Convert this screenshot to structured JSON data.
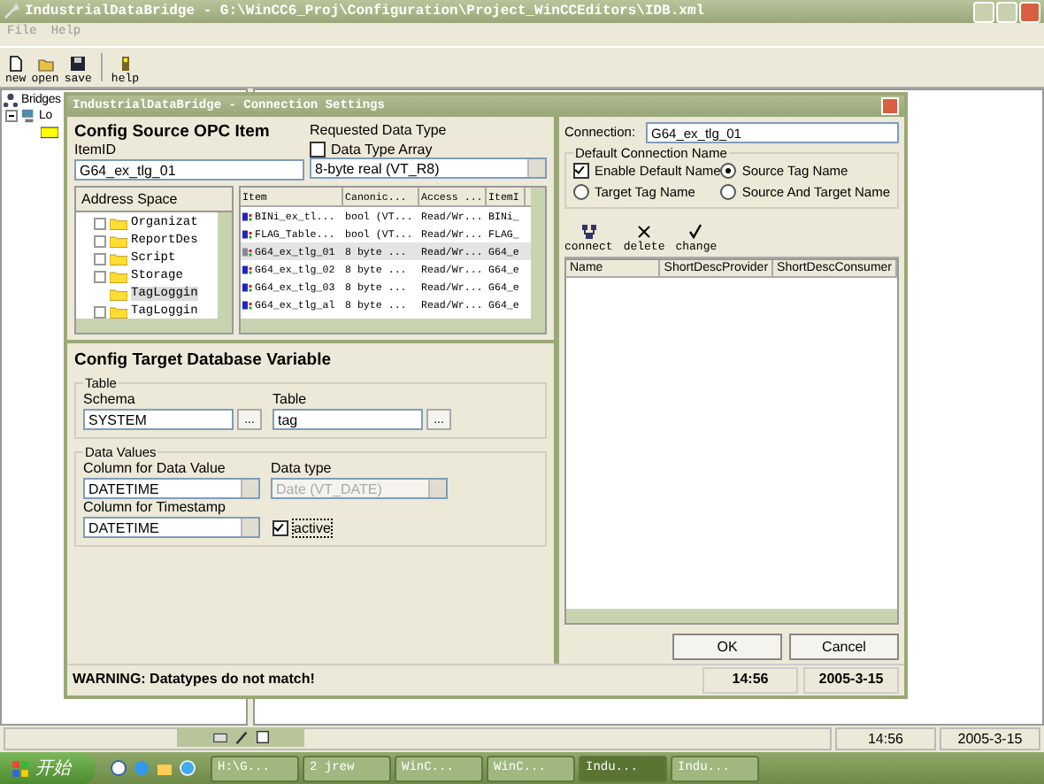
{
  "window": {
    "title": "IndustrialDataBridge - G:\\WinCC6_Proj\\Configuration\\Project_WinCCEditors\\IDB.xml"
  },
  "menu": [
    "File",
    "Help"
  ],
  "toolbar": [
    {
      "label": "new",
      "kind": "new"
    },
    {
      "label": "open",
      "kind": "open"
    },
    {
      "label": "save",
      "kind": "save"
    },
    {
      "label": "help",
      "kind": "help"
    }
  ],
  "tree": [
    {
      "label": "Bridges",
      "children": [
        {
          "label": "Lo",
          "expanded": true
        }
      ]
    }
  ],
  "status_bar": {
    "time": "14:56",
    "date": "2005-3-15"
  },
  "dialog": {
    "title": "IndustrialDataBridge - Connection Settings",
    "source": {
      "heading": "Config Source OPC Item",
      "item_id_label": "ItemID",
      "item_id": "G64_ex_tlg_01",
      "requested_label": "Requested Data Type",
      "array_label": "Data Type Array",
      "array_checked": false,
      "data_type": "8-byte real (VT_R8)",
      "address_space_label": "Address Space",
      "address_tree": [
        {
          "label": "Organizat",
          "expandable": true,
          "selected": false
        },
        {
          "label": "ReportDes",
          "expandable": true,
          "selected": false
        },
        {
          "label": "Script",
          "expandable": true,
          "selected": false
        },
        {
          "label": "Storage",
          "expandable": true,
          "selected": false
        },
        {
          "label": "TagLoggin",
          "expandable": false,
          "selected": true
        },
        {
          "label": "TagLoggin",
          "expandable": true,
          "selected": false
        }
      ],
      "columns": [
        "Item",
        "Canonic...",
        "Access ...",
        "ItemI"
      ],
      "rows": [
        {
          "cells": [
            "BINi_ex_tl...",
            "bool (VT...",
            "Read/Wr...",
            "BINi_"
          ],
          "selected": false
        },
        {
          "cells": [
            "FLAG_Table...",
            "bool (VT...",
            "Read/Wr...",
            "FLAG_"
          ],
          "selected": false
        },
        {
          "cells": [
            "G64_ex_tlg_01",
            "8 byte ...",
            "Read/Wr...",
            "G64_e"
          ],
          "selected": true
        },
        {
          "cells": [
            "G64_ex_tlg_02",
            "8 byte ...",
            "Read/Wr...",
            "G64_e"
          ],
          "selected": false
        },
        {
          "cells": [
            "G64_ex_tlg_03",
            "8 byte ...",
            "Read/Wr...",
            "G64_e"
          ],
          "selected": false
        },
        {
          "cells": [
            "G64_ex_tlg_al",
            "8 byte ...",
            "Read/Wr...",
            "G64_e"
          ],
          "selected": false
        }
      ]
    },
    "target": {
      "heading": "Config Target Database Variable",
      "table_group": "Table",
      "schema_label": "Schema",
      "schema": "SYSTEM",
      "table_label": "Table",
      "table": "tag",
      "browse": "...",
      "values_group": "Data Values",
      "value_col_label": "Column for Data Value",
      "value_col": "DATETIME",
      "datatype_label": "Data type",
      "datatype": "Date (VT_DATE)",
      "datatype_disabled": true,
      "ts_label": "Column for Timestamp",
      "ts": "DATETIME",
      "active_label": "active",
      "active_checked": true
    },
    "connection": {
      "label": "Connection:",
      "value": "G64_ex_tlg_01",
      "group": "Default Connection Name",
      "enable_label": "Enable Default Name",
      "enable_checked": true,
      "radios": [
        {
          "label": "Source Tag Name",
          "selected": true
        },
        {
          "label": "Target Tag Name",
          "selected": false
        },
        {
          "label": "Source And Target Name",
          "selected": false
        }
      ],
      "tools": [
        {
          "label": "connect",
          "kind": "connect"
        },
        {
          "label": "delete",
          "kind": "delete"
        },
        {
          "label": "change",
          "kind": "change"
        }
      ],
      "columns": [
        "Name",
        "ShortDescProvider",
        "ShortDescConsumer"
      ]
    },
    "buttons": [
      "OK",
      "Cancel"
    ],
    "status": {
      "message": "WARNING: Datatypes do not match!",
      "time": "14:56",
      "date": "2005-3-15"
    }
  },
  "taskbar": {
    "start": "开始",
    "tasks": [
      {
        "label": "H:\\G...",
        "selected": false
      },
      {
        "label": "2 jrew",
        "selected": false
      },
      {
        "label": "WinC...",
        "selected": false
      },
      {
        "label": "WinC...",
        "selected": false
      },
      {
        "label": "Indu...",
        "selected": true
      },
      {
        "label": "Indu...",
        "selected": false
      }
    ]
  }
}
